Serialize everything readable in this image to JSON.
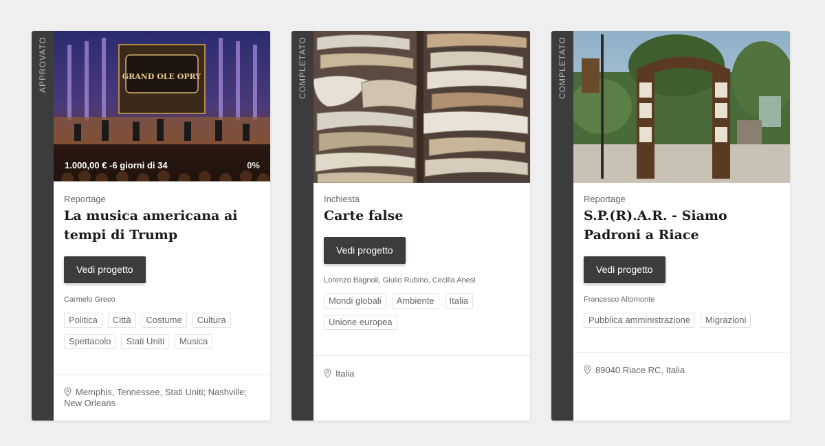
{
  "cards": [
    {
      "status": "APPROVATO",
      "funding": "1.000,00 € -6 giorni di 34",
      "percent": "0%",
      "category": "Reportage",
      "title": "La musica americana ai tempi di Trump",
      "button": "Vedi progetto",
      "authors": "Carmelo Greco",
      "tags": [
        "Politica",
        "Città",
        "Costume",
        "Cultura",
        "Spettacolo",
        "Stati Uniti",
        "Musica"
      ],
      "location": "Memphis, Tennessee, Stati Uniti; Nashville; New Orleans",
      "image_sign": "GRAND OLE OPRY"
    },
    {
      "status": "COMPLETATO",
      "category": "Inchiesta",
      "title": "Carte false",
      "button": "Vedi progetto",
      "authors": "Lorenzo Bagnoli, Giulio Rubino, Cecilia Anesi",
      "tags": [
        "Mondi globali",
        "Ambiente",
        "Italia",
        "Unione europea"
      ],
      "location": "Italia"
    },
    {
      "status": "COMPLETATO",
      "category": "Reportage",
      "title": "S.P.(R).A.R. - Siamo Padroni a Riace",
      "button": "Vedi progetto",
      "authors": "Francesco Altomonte",
      "tags": [
        "Pubblica amministrazione",
        "Migrazioni"
      ],
      "location": "89040 Riace RC, Italia"
    }
  ],
  "colors": {
    "background": "#efefef",
    "status_bar": "#3d3c3c",
    "button": "#3d3c3c",
    "tag_border": "#e3e3e3"
  },
  "icons": {
    "location": "map-pin-icon"
  }
}
